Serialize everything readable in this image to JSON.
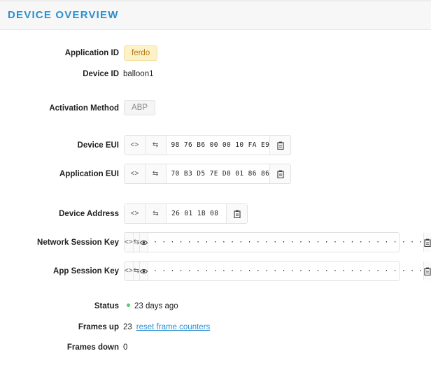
{
  "header": {
    "title": "DEVICE OVERVIEW"
  },
  "fields": {
    "application_id": {
      "label": "Application ID",
      "value": "ferdo"
    },
    "device_id": {
      "label": "Device ID",
      "value": "balloon1"
    },
    "activation_method": {
      "label": "Activation Method",
      "value": "ABP"
    },
    "device_eui": {
      "label": "Device EUI",
      "value": "98 76 B6 00 00 10 FA E9"
    },
    "application_eui": {
      "label": "Application EUI",
      "value": "70 B3 D5 7E D0 01 86 86"
    },
    "device_address": {
      "label": "Device Address",
      "value": "26 01 1B 08"
    },
    "network_session_key": {
      "label": "Network Session Key",
      "value": "· · · · · · · · · · · · · · · · · · · · · · · · · · · · · · · ·"
    },
    "app_session_key": {
      "label": "App Session Key",
      "value": "· · · · · · · · · · · · · · · · · · · · · · · · · · · · · · · ·"
    },
    "status": {
      "label": "Status",
      "value": "23 days ago"
    },
    "frames_up": {
      "label": "Frames up",
      "value": "23",
      "action": "reset frame counters"
    },
    "frames_down": {
      "label": "Frames down",
      "value": "0"
    }
  },
  "icons": {
    "toggle_format": "code-brackets-icon",
    "swap_order": "swap-arrows-icon",
    "reveal": "eye-icon",
    "copy": "clipboard-icon"
  },
  "colors": {
    "accent": "#2b8fd0",
    "status_ok": "#4fd16b",
    "app_tag_bg": "#fdf1c8"
  }
}
